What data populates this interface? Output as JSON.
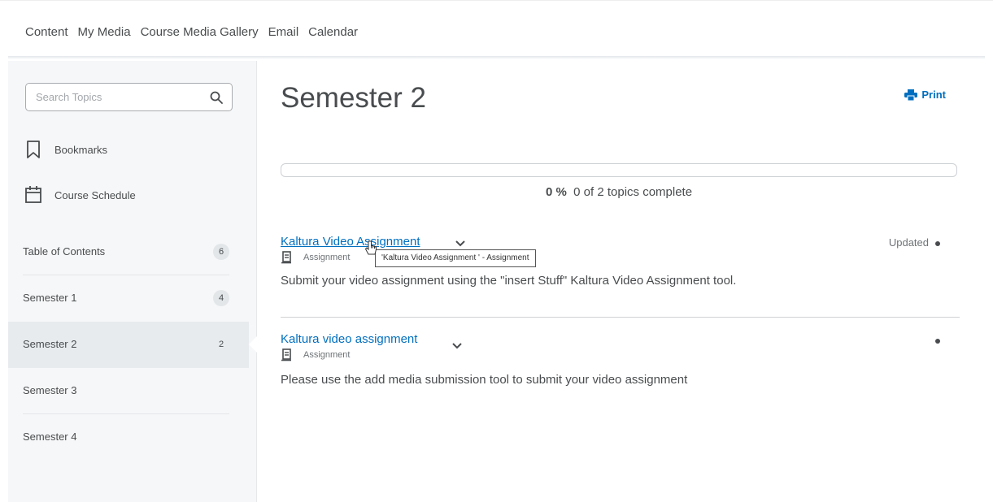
{
  "nav": {
    "items": [
      "Content",
      "My Media",
      "Course Media Gallery",
      "Email",
      "Calendar"
    ]
  },
  "sidebar": {
    "search_placeholder": "Search Topics",
    "tools": [
      {
        "label": "Bookmarks",
        "icon": "bookmark-icon"
      },
      {
        "label": "Course Schedule",
        "icon": "calendar-icon"
      }
    ],
    "toc": [
      {
        "label": "Table of Contents",
        "count": "6"
      },
      {
        "label": "Semester 1",
        "count": "4"
      },
      {
        "label": "Semester 2",
        "count": "2",
        "active": true
      },
      {
        "label": "Semester 3",
        "count": ""
      },
      {
        "label": "Semester 4",
        "count": ""
      }
    ]
  },
  "main": {
    "title": "Semester 2",
    "print_label": "Print",
    "progress": {
      "percent_label": "0 %",
      "summary": "0 of 2 topics complete",
      "fraction": 0
    },
    "topics": [
      {
        "title": "Kaltura Video Assignment",
        "type": "Assignment",
        "description": "Submit your video assignment using the \"insert Stuff\"  Kaltura Video Assignment  tool.",
        "status": "Updated",
        "tooltip": "'Kaltura Video Assignment ' - Assignment"
      },
      {
        "title": "Kaltura video assignment",
        "type": "Assignment",
        "description": "Please use the add media submission tool to submit your video assignment",
        "status": ""
      }
    ]
  },
  "colors": {
    "link": "#006fbf",
    "text": "#494c4e",
    "sidebar_bg": "#f6f7f8",
    "active_bg": "#e8ebee"
  }
}
